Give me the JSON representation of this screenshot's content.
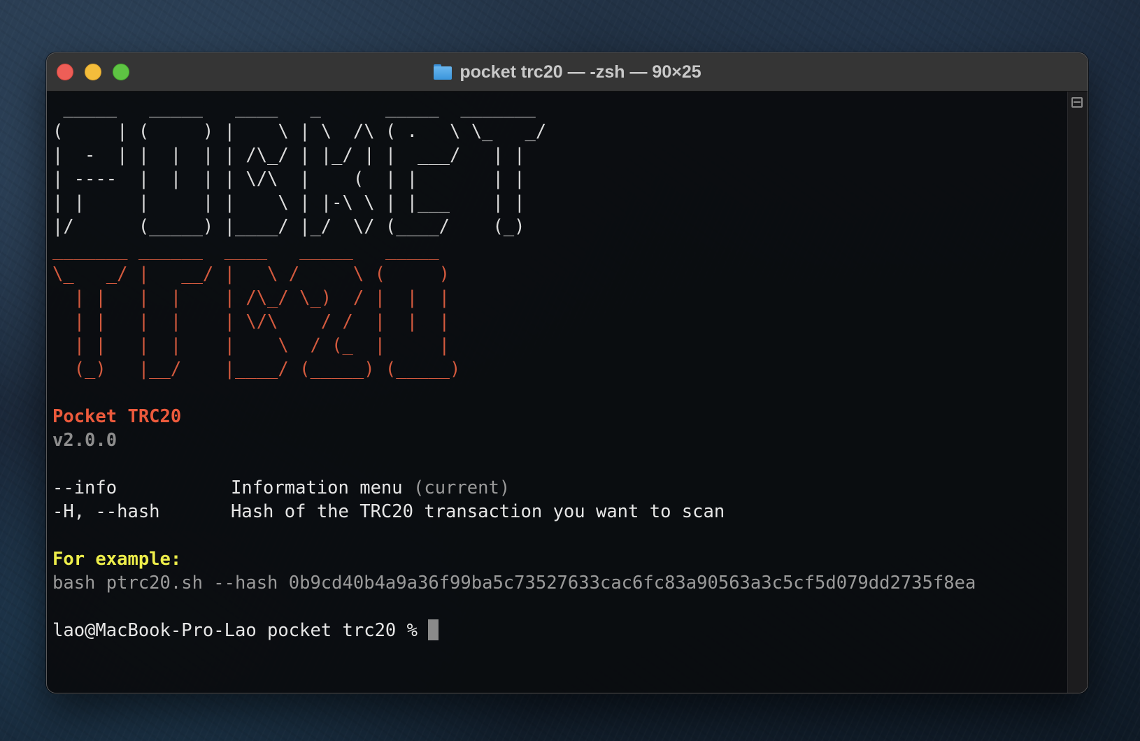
{
  "window": {
    "title": "pocket trc20 — -zsh — 90×25"
  },
  "banner": {
    "pocket_ascii": " _____   _____   ____   _      _____  _______\n(     | (     ) |    \\ | \\  /\\ ( .   \\ \\_   _/\n|  -  | |  |  | | /\\_/ | |_/ | |  ___/   | |\n| ----  |  |  | | \\/\\  |    (  | |       | |\n| |     |     | |    \\ | |-\\ \\ | |___    | |\n|/      (_____) |____/ |_/  \\/ (____/    (_)",
    "trc20_ascii": "_______ ______  ____   _____   _____\n\\_   _/ |   __/ |   \\ /     \\ (     )\n  | |   |  |    | /\\_/ \\_)  / |  |  |\n  | |   |  |    | \\/\\    / /  |  |  |\n  | |   |  |    |    \\  / (_  |     |\n  (_)   |__/    |____/ (_____) (_____)"
  },
  "app": {
    "name": "Pocket TRC20",
    "version": "v2.0.0"
  },
  "options": [
    {
      "flag": "--info",
      "description": "Information menu",
      "note": "(current)"
    },
    {
      "flag": "-H, --hash",
      "description": "Hash of the TRC20 transaction you want to scan",
      "note": ""
    }
  ],
  "example": {
    "label": "For example:",
    "command": "bash ptrc20.sh --hash 0b9cd40b4a9a36f99ba5c73527633cac6fc83a90563a3c5cf5d079dd2735f8ea"
  },
  "prompt": {
    "text": "lao@MacBook-Pro-Lao pocket trc20 % "
  }
}
